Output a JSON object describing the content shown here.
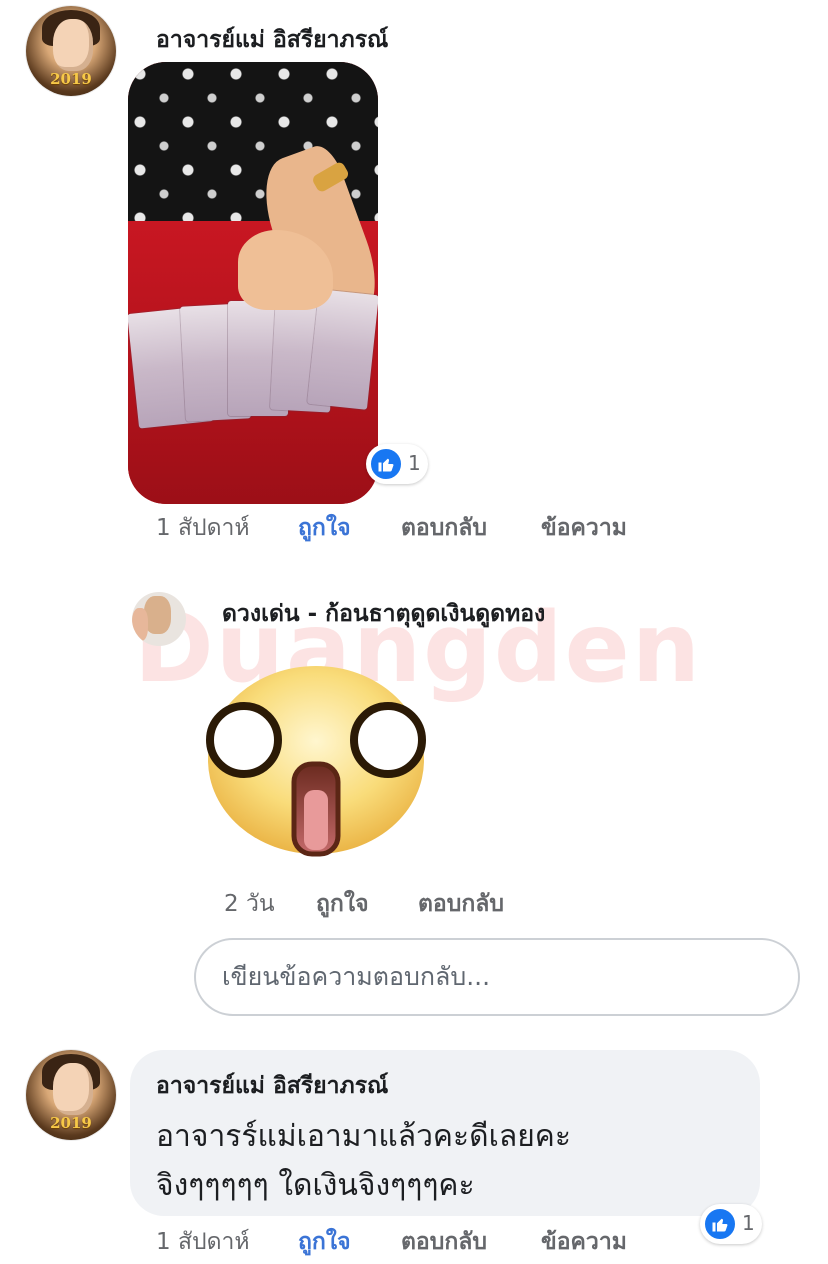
{
  "comments": [
    {
      "author": "อาจารย์แม่ อิสรียาภรณ์",
      "avatar_badge": "2019",
      "time": "1 สัปดาห์",
      "actions": {
        "like": "ถูกใจ",
        "reply": "ตอบกลับ",
        "message": "ข้อความ"
      },
      "reaction": {
        "icon": "thumbs-up-icon",
        "count": "1"
      }
    },
    {
      "author": "ดวงเด่น - ก้อนธาตุดูดเงินดูดทอง",
      "sticker": "shocked-face-sticker",
      "time": "2 วัน",
      "actions": {
        "like": "ถูกใจ",
        "reply": "ตอบกลับ"
      }
    },
    {
      "author": "อาจารย์แม่ อิสรียาภรณ์",
      "avatar_badge": "2019",
      "text_line1": "อาจารร์แม่เอามาแล้วคะดีเลยคะ",
      "text_line2": "จิงๆๆๆๆๆ ใดเงินจิงๆๆๆคะ",
      "time": "1 สัปดาห์",
      "actions": {
        "like": "ถูกใจ",
        "reply": "ตอบกลับ",
        "message": "ข้อความ"
      },
      "reaction": {
        "icon": "thumbs-up-icon",
        "count": "1"
      }
    }
  ],
  "reply_box": {
    "placeholder": "เขียนข้อความตอบกลับ..."
  },
  "watermark": "Duangden",
  "colors": {
    "like_blue": "#1877f2",
    "link_blue": "#3b74d6",
    "meta_gray": "#65676b",
    "bubble_bg": "#f0f2f5"
  }
}
